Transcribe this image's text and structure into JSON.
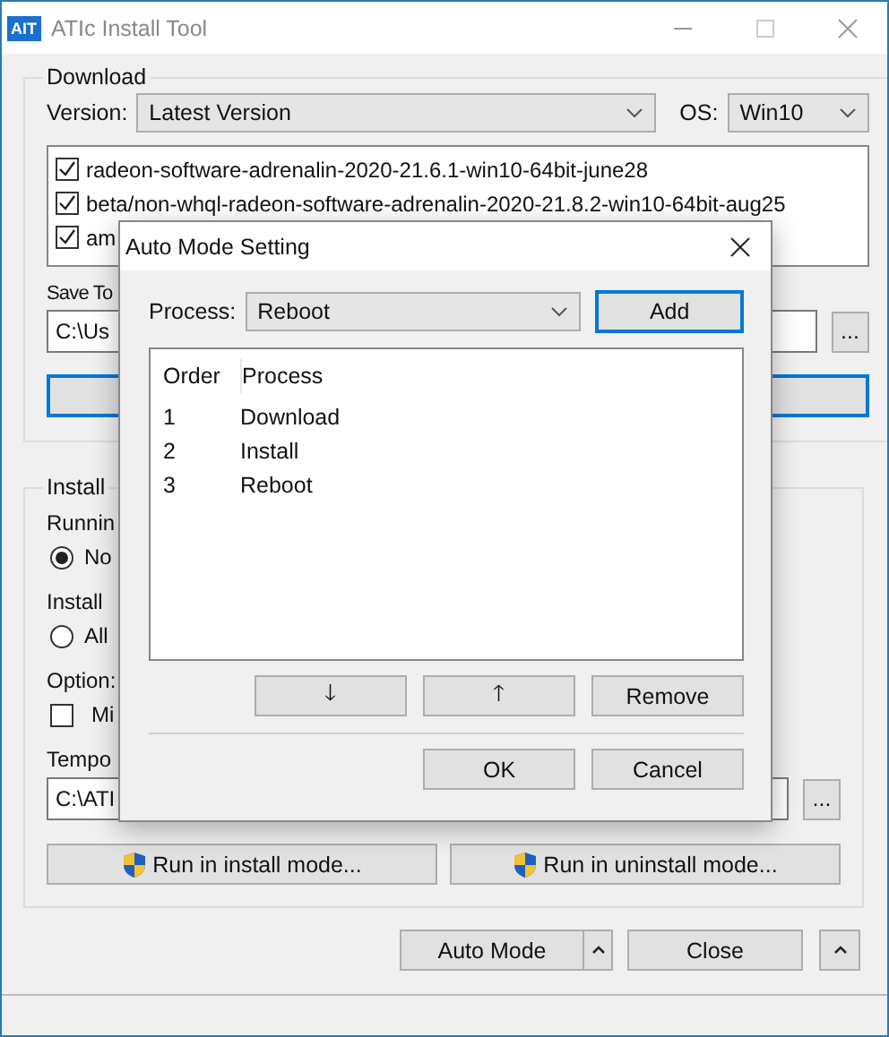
{
  "window": {
    "app_icon": "AIT",
    "title": "ATIc Install Tool"
  },
  "download": {
    "title": "Download",
    "version_label": "Version:",
    "version_value": "Latest Version",
    "os_label": "OS:",
    "os_value": "Win10",
    "files": [
      {
        "name": "radeon-software-adrenalin-2020-21.6.1-win10-64bit-june28",
        "checked": true
      },
      {
        "name": "beta/non-whql-radeon-software-adrenalin-2020-21.8.2-win10-64bit-aug25",
        "checked": true
      },
      {
        "name": "am",
        "checked": true
      }
    ],
    "save_to_label": "Save To",
    "save_to_value": "C:\\Us",
    "browse_button": "..."
  },
  "install_mode": {
    "title": "Install",
    "running_label": "Runnin",
    "running_options": [
      {
        "label": "No",
        "selected": true
      }
    ],
    "install_label": "Install",
    "install_options": [
      {
        "label": "All",
        "selected": false
      }
    ],
    "option_label": "Option:",
    "options": [
      {
        "label": "Mi",
        "checked": false
      }
    ],
    "temp_label": "Tempo",
    "temp_value": "C:\\ATI",
    "browse_button": "...",
    "run_buttons": [
      "Run in install mode...",
      "Run in uninstall mode..."
    ]
  },
  "footer": {
    "auto_mode_button": "Auto Mode",
    "close_button": "Close"
  },
  "dialog": {
    "title": "Auto Mode Setting",
    "process_label": "Process:",
    "process_value": "Reboot",
    "add_button": "Add",
    "columns": [
      "Order",
      "Process"
    ],
    "rows": [
      [
        "1",
        "Download"
      ],
      [
        "2",
        "Install"
      ],
      [
        "3",
        "Reboot"
      ]
    ],
    "down_button": "🡓",
    "up_button": "🡑",
    "remove_button": "Remove",
    "ok_button": "OK",
    "cancel_button": "Cancel"
  }
}
